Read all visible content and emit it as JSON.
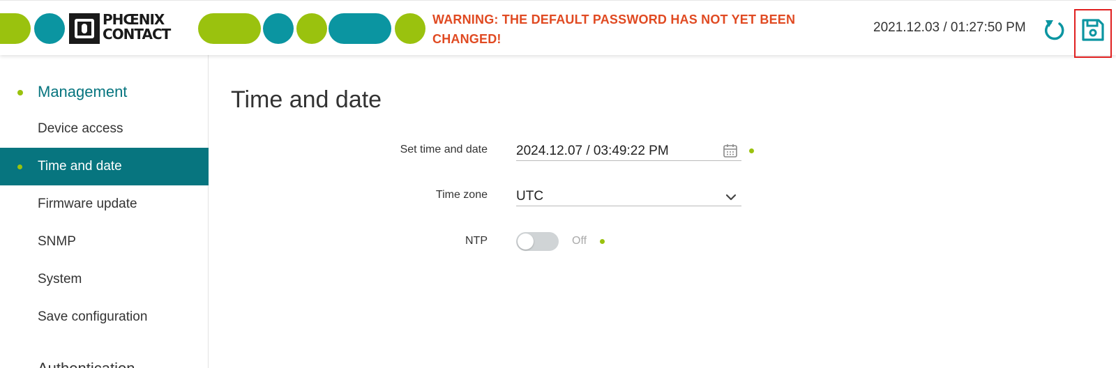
{
  "header": {
    "logo_text_line1": "PHŒNIX",
    "logo_text_line2": "CONTACT",
    "warning": "WARNING: THE DEFAULT PASSWORD HAS NOT YET BEEN CHANGED!",
    "clock": "2021.12.03 / 01:27:50 PM",
    "reload_icon": "reload-icon",
    "save_icon": "save-icon",
    "colors": {
      "lime": "#9ac20e",
      "teal": "#0b95a1",
      "warning": "#e04a22"
    }
  },
  "sidebar": {
    "group_label": "Management",
    "items": [
      {
        "label": "Device access",
        "active": false
      },
      {
        "label": "Time and date",
        "active": true
      },
      {
        "label": "Firmware update",
        "active": false
      },
      {
        "label": "SNMP",
        "active": false
      },
      {
        "label": "System",
        "active": false
      },
      {
        "label": "Save configuration",
        "active": false
      }
    ],
    "next_group_label": "Authentication",
    "active_color": "#07757f"
  },
  "main": {
    "title": "Time and date",
    "set_time": {
      "label": "Set time and date",
      "value": "2024.12.07 / 03:49:22 PM",
      "icon": "calendar-icon"
    },
    "time_zone": {
      "label": "Time zone",
      "value": "UTC",
      "icon": "chevron-down-icon"
    },
    "ntp": {
      "label": "NTP",
      "state": "Off"
    }
  }
}
